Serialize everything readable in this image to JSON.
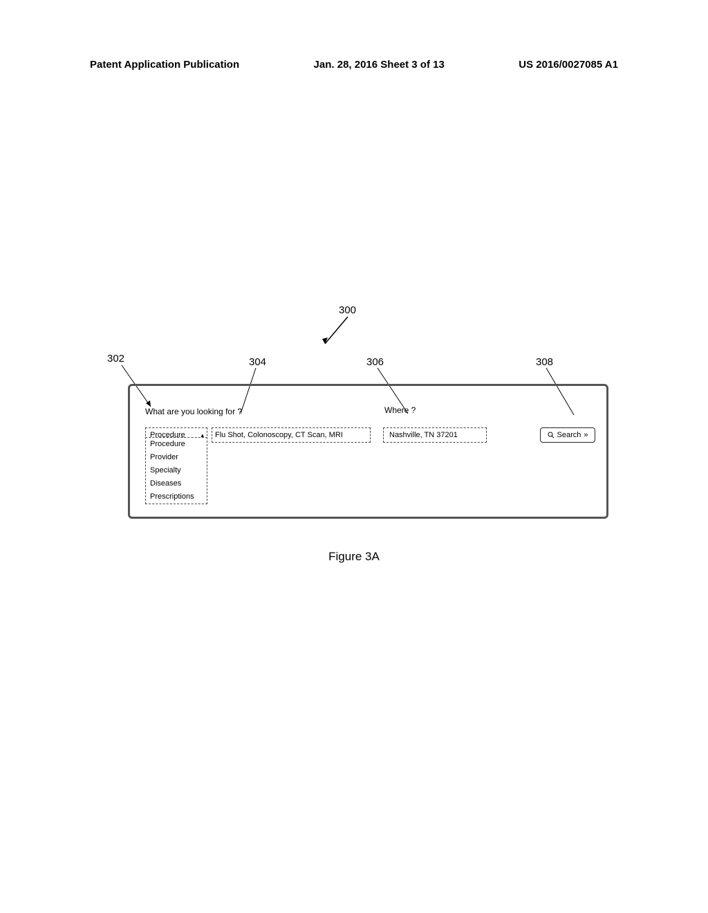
{
  "header": {
    "left": "Patent Application Publication",
    "center": "Jan. 28, 2016  Sheet 3 of 13",
    "right": "US 2016/0027085 A1"
  },
  "refs": {
    "r300": "300",
    "r302": "302",
    "r304": "304",
    "r306": "306",
    "r308": "308"
  },
  "search": {
    "label_what": "What are you looking for ?",
    "label_where": "Where ?",
    "dropdown_selected": "Procedure",
    "procedure_placeholder": "Flu Shot, Colonoscopy, CT Scan, MRI",
    "where_value": "Nashville, TN 37201",
    "button_label": "Search",
    "button_arrow": "»",
    "dropdown_options": {
      "o0": "Procedure",
      "o1": "Provider",
      "o2": "Specialty",
      "o3": "Diseases",
      "o4": "Prescriptions"
    }
  },
  "caption": "Figure 3A"
}
